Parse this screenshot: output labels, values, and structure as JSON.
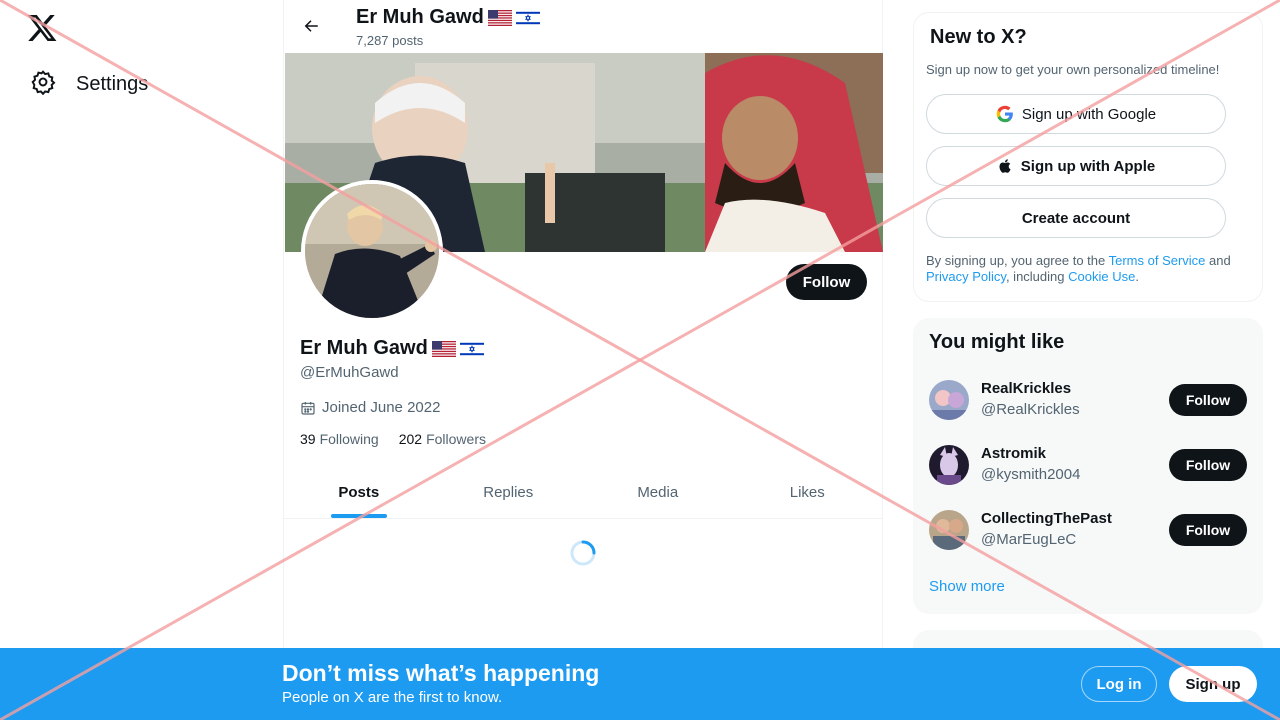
{
  "nav": {
    "settings_label": "Settings"
  },
  "profile": {
    "name": "Er Muh Gawd",
    "post_count": "7,287 posts",
    "handle": "@ErMuhGawd",
    "joined": "Joined June 2022",
    "following_count": "39",
    "following_label": "Following",
    "followers_count": "202",
    "followers_label": "Followers",
    "follow_label": "Follow"
  },
  "tabs": [
    "Posts",
    "Replies",
    "Media",
    "Likes"
  ],
  "signup_card": {
    "title": "New to X?",
    "subtitle": "Sign up now to get your own personalized timeline!",
    "google_label": "Sign up with Google",
    "apple_label": "Sign up with Apple",
    "create_label": "Create account",
    "terms_prefix": "By signing up, you agree to the ",
    "terms_link": "Terms of Service",
    "terms_and": " and ",
    "privacy_link": "Privacy Policy",
    "terms_including": ", including ",
    "cookie_link": "Cookie Use",
    "terms_suffix": "."
  },
  "suggestions": {
    "title": "You might like",
    "items": [
      {
        "name": "RealKrickles",
        "handle": "@RealKrickles",
        "follow": "Follow"
      },
      {
        "name": "Astromik",
        "handle": "@kysmith2004",
        "follow": "Follow"
      },
      {
        "name": "CollectingThePast",
        "handle": "@MarEugLeC",
        "follow": "Follow"
      }
    ],
    "show_more": "Show more"
  },
  "bottom_bar": {
    "title": "Don’t miss what’s happening",
    "subtitle": "People on X are the first to know.",
    "login": "Log in",
    "signup": "Sign up"
  },
  "colors": {
    "accent": "#1d9bf0",
    "text": "#0f1419",
    "muted": "#536471",
    "overlay": "#f5a0a0"
  }
}
